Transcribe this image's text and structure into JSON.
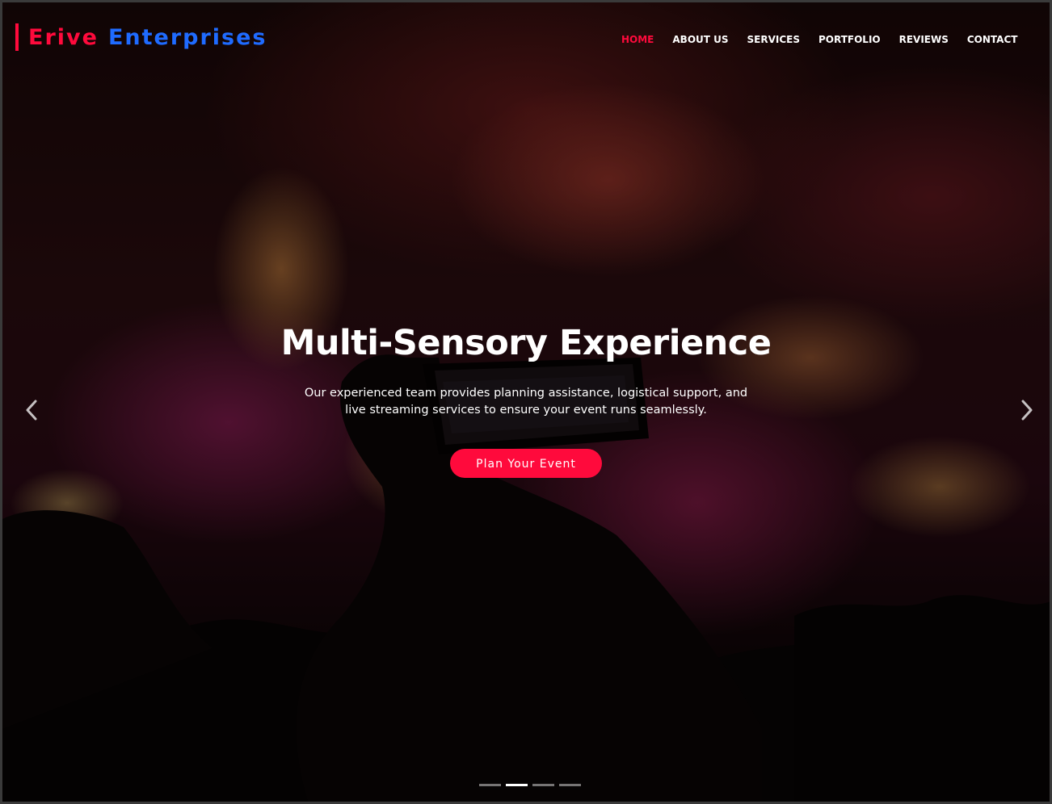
{
  "brand": {
    "word1": "Erive",
    "word2": "Enterprises",
    "colors": {
      "primary": "#ff0a3c",
      "secondary": "#1f6bff"
    }
  },
  "nav": {
    "items": [
      {
        "label": "HOME",
        "active": true
      },
      {
        "label": "ABOUT US",
        "active": false
      },
      {
        "label": "SERVICES",
        "active": false
      },
      {
        "label": "PORTFOLIO",
        "active": false
      },
      {
        "label": "REVIEWS",
        "active": false
      },
      {
        "label": "CONTACT",
        "active": false
      }
    ]
  },
  "hero": {
    "title": "Multi-Sensory Experience",
    "text": "Our experienced team provides planning assistance, logistical support, and live streaming services to ensure your event runs seamlessly.",
    "cta_label": "Plan Your Event",
    "prev_icon": "chevron-left-icon",
    "next_icon": "chevron-right-icon"
  },
  "carousel": {
    "slide_count": 4,
    "active_index": 1
  }
}
